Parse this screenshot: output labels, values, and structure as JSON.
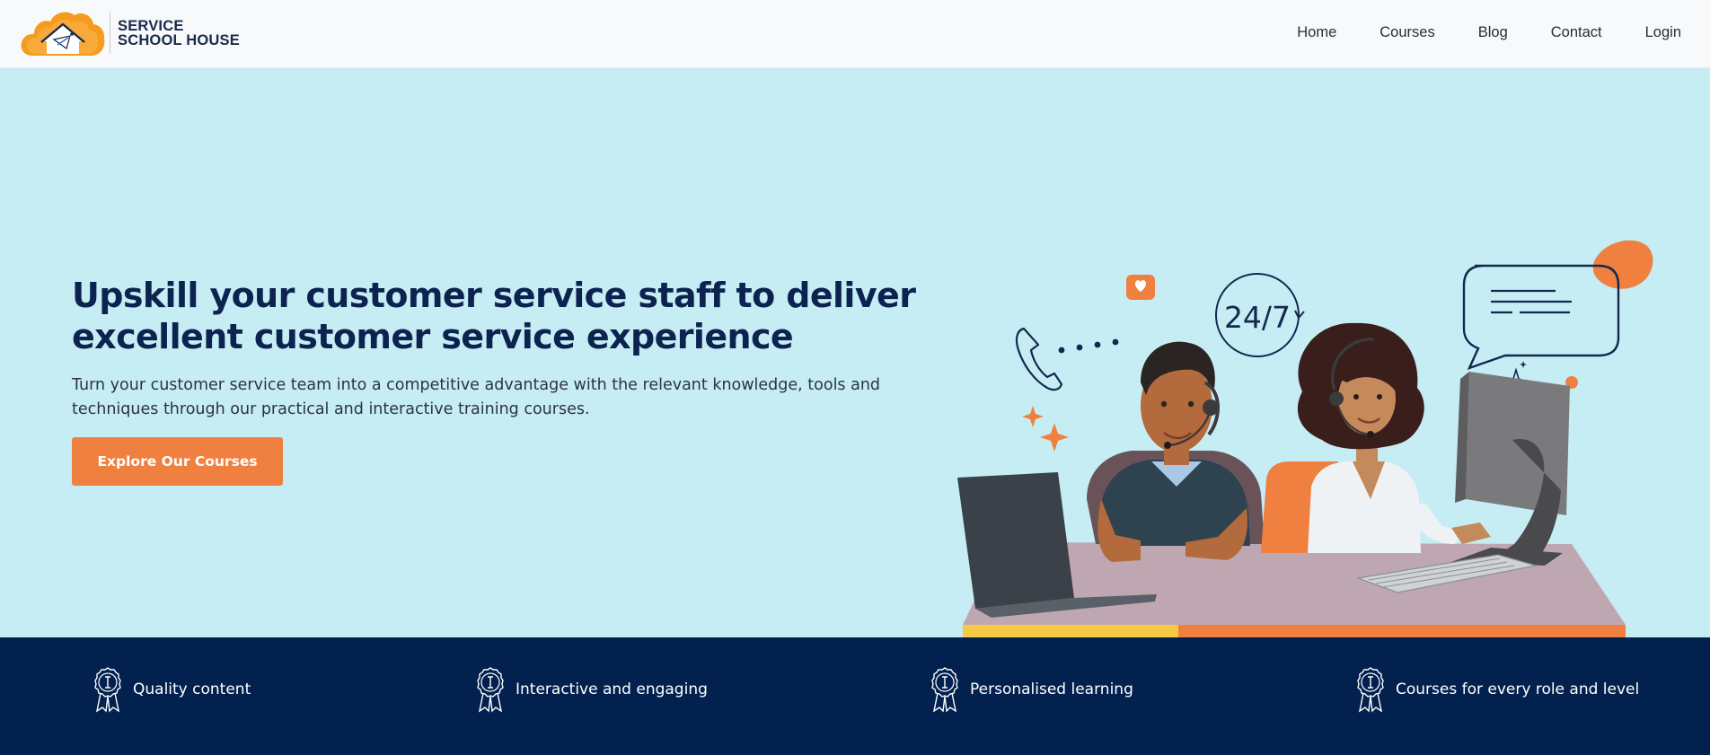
{
  "brand": {
    "line1": "SERVICE",
    "line2": "SCHOOL HOUSE",
    "icon": "cloud-house-logo",
    "color_orange": "#f59b1e",
    "color_navy": "#1b2a4e"
  },
  "nav": {
    "items": [
      {
        "label": "Home"
      },
      {
        "label": "Courses"
      },
      {
        "label": "Blog"
      },
      {
        "label": "Contact"
      },
      {
        "label": "Login"
      }
    ]
  },
  "hero": {
    "title_line1": "Upskill your customer service staff to deliver",
    "title_line2": "excellent customer service experience",
    "subtitle_line1": "Turn your customer service team into a competitive advantage with the relevant knowledge, tools and",
    "subtitle_line2": "techniques through our practical and interactive training courses.",
    "cta_label": "Explore Our Courses",
    "illustration_text": "24/7",
    "background": "#c6edf4",
    "accent": "#f08040"
  },
  "features": {
    "background": "#03214f",
    "items": [
      {
        "label": "Quality content",
        "icon": "award-ribbon-icon"
      },
      {
        "label": "Interactive and engaging",
        "icon": "award-ribbon-icon"
      },
      {
        "label": "Personalised learning",
        "icon": "award-ribbon-icon"
      },
      {
        "label": "Courses for every role and level",
        "icon": "award-ribbon-icon"
      }
    ]
  }
}
